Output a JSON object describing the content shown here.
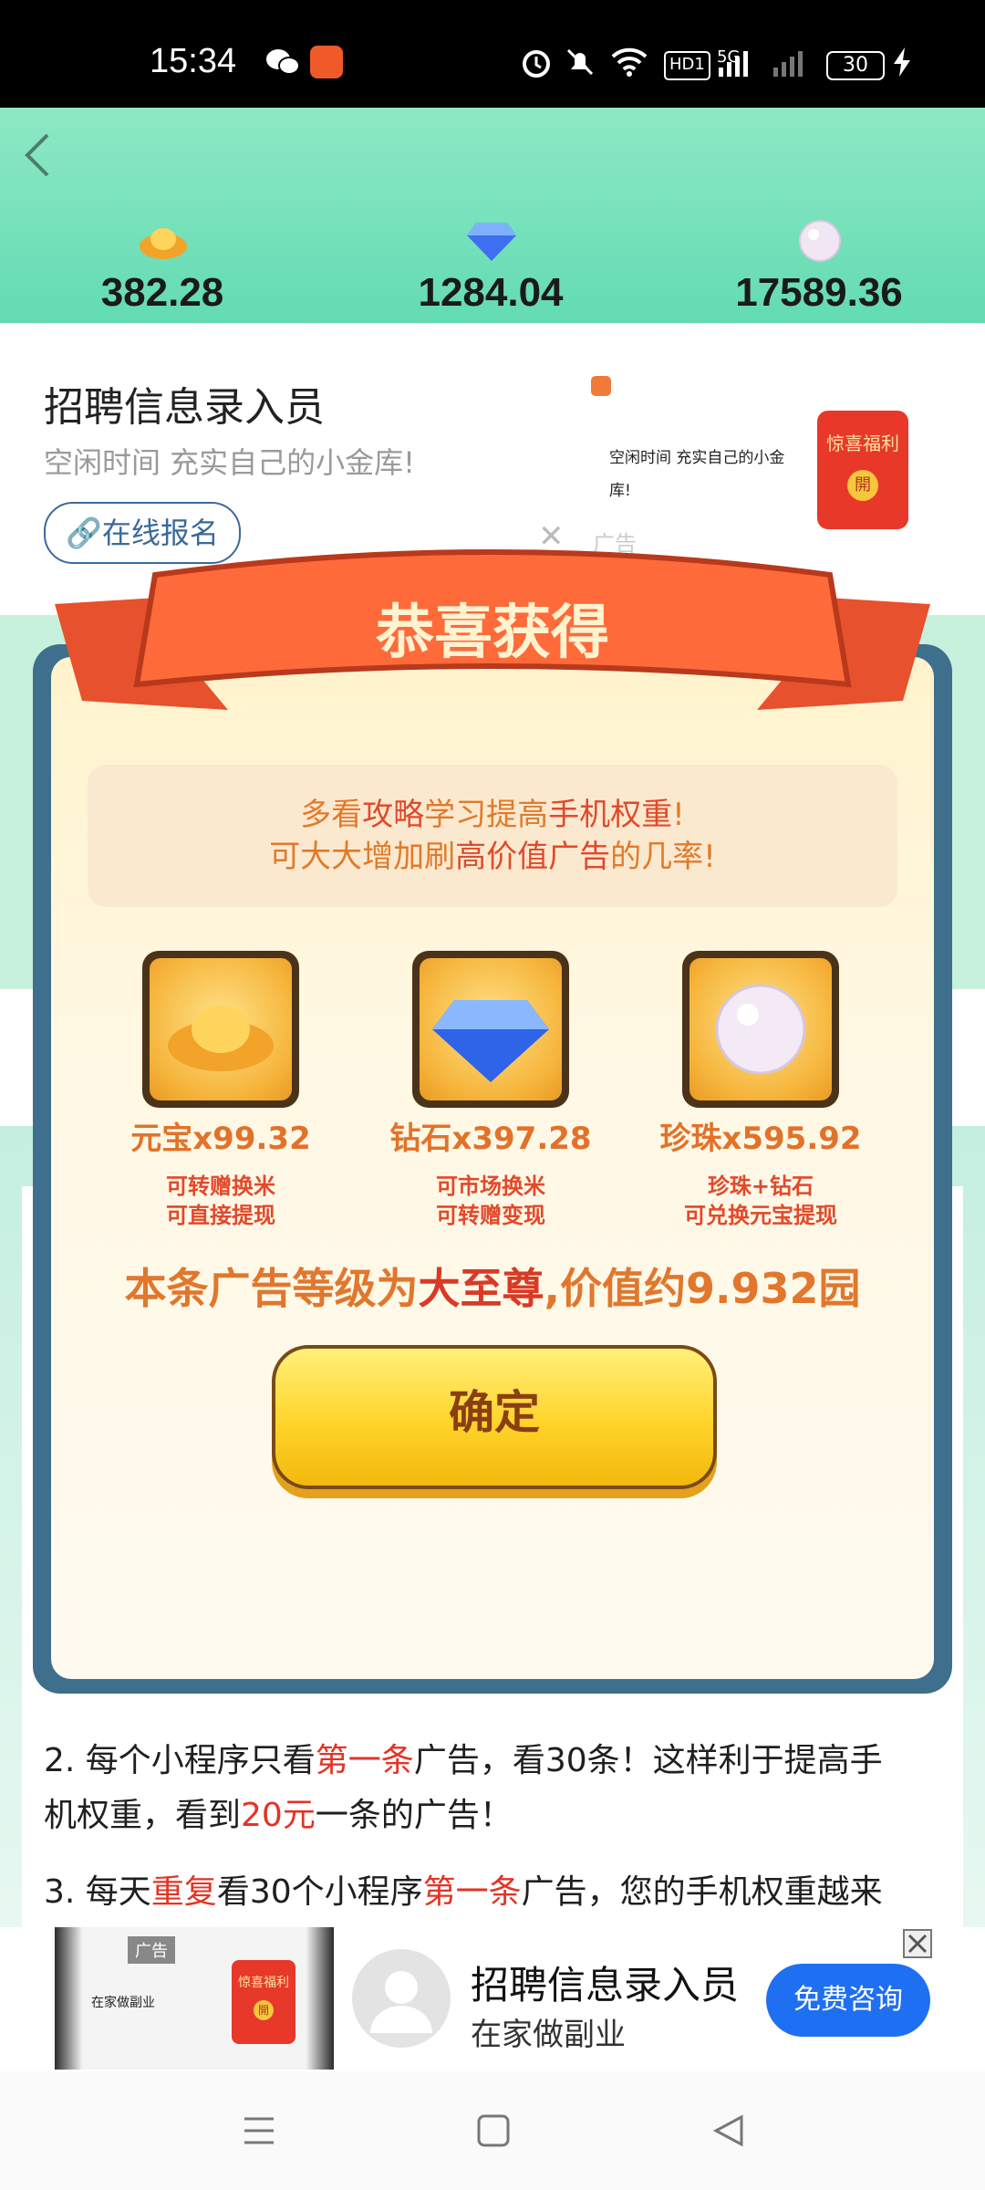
{
  "status_bar": {
    "time": "15:34",
    "network": "5G",
    "hd_label": "HD1",
    "battery": "30"
  },
  "balances": [
    {
      "icon": "gold-ingot-icon",
      "value": "382.28"
    },
    {
      "icon": "diamond-icon",
      "value": "1284.04"
    },
    {
      "icon": "pearl-icon",
      "value": "17589.36"
    }
  ],
  "top_ad": {
    "title": "招聘信息录入员",
    "subtitle": "空闲时间 充实自己的小金库!",
    "button": "在线报名",
    "right_text": "空闲时间 充实自己的小金库!",
    "badge": "惊喜福利",
    "badge_sub": "開",
    "ad_label": "广告"
  },
  "modal": {
    "title": "恭喜获得",
    "tip_line1_parts": [
      "多看",
      "攻略",
      "学习提高",
      "手机权重",
      "!"
    ],
    "tip_line2_parts": [
      "可大大增加刷",
      "高价值广告",
      "的几率!"
    ],
    "rewards": [
      {
        "label": "元宝x99.32",
        "sub1": "可转赠换米",
        "sub2": "可直接提现",
        "icon": "gold-ingot-icon"
      },
      {
        "label": "钻石x397.28",
        "sub1": "可市场换米",
        "sub2": "可转赠变现",
        "icon": "diamond-icon"
      },
      {
        "label": "珍珠x595.92",
        "sub1": "珍珠+钻石",
        "sub2": "可兑换元宝提现",
        "icon": "pearl-icon"
      }
    ],
    "level_prefix": "本条广告等级为",
    "level_name": "大至尊",
    "level_suffix": ",价值约9.932园",
    "confirm": "确定"
  },
  "content": {
    "p2_a": "2. 每个小程序只看",
    "p2_b": "第一条",
    "p2_c": "广告，看30条！这样利于提高手",
    "p2_d": "机权重，看到",
    "p2_e": "20元",
    "p2_f": "一条的广告！",
    "p3_a": "3. 每天",
    "p3_b": "重复",
    "p3_c": "看30个小程序",
    "p3_d": "第一条",
    "p3_e": "广告，您的手机权重越来"
  },
  "bottom_ad": {
    "ad_label": "广告",
    "thumb_text": "在家做副业",
    "badge": "惊喜福利",
    "badge_sub": "開",
    "title": "招聘信息录入员",
    "subtitle": "在家做副业",
    "button": "免费咨询"
  }
}
